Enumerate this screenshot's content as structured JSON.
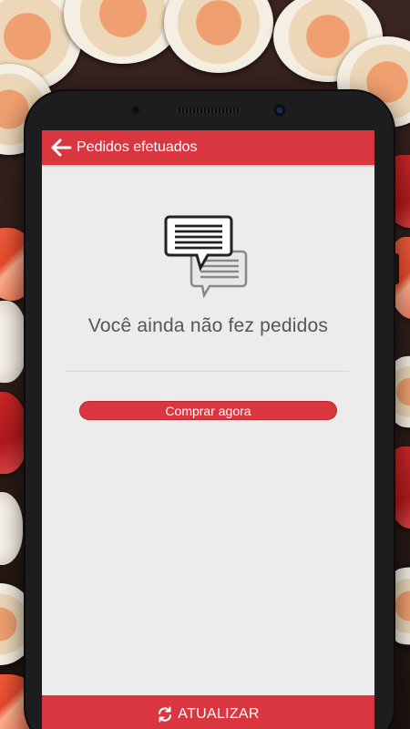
{
  "appbar": {
    "back_icon": "arrow-left-icon",
    "title": "Pedidos efetuados"
  },
  "empty_state": {
    "icon": "chat-bubbles-icon",
    "message": "Você ainda não fez pedidos"
  },
  "actions": {
    "buy_now_label": "Comprar agora",
    "refresh_label": "ATUALIZAR",
    "refresh_icon": "refresh-icon"
  },
  "colors": {
    "brand_red": "#d93640",
    "screen_bg": "#ececec",
    "text_gray": "#555555"
  }
}
